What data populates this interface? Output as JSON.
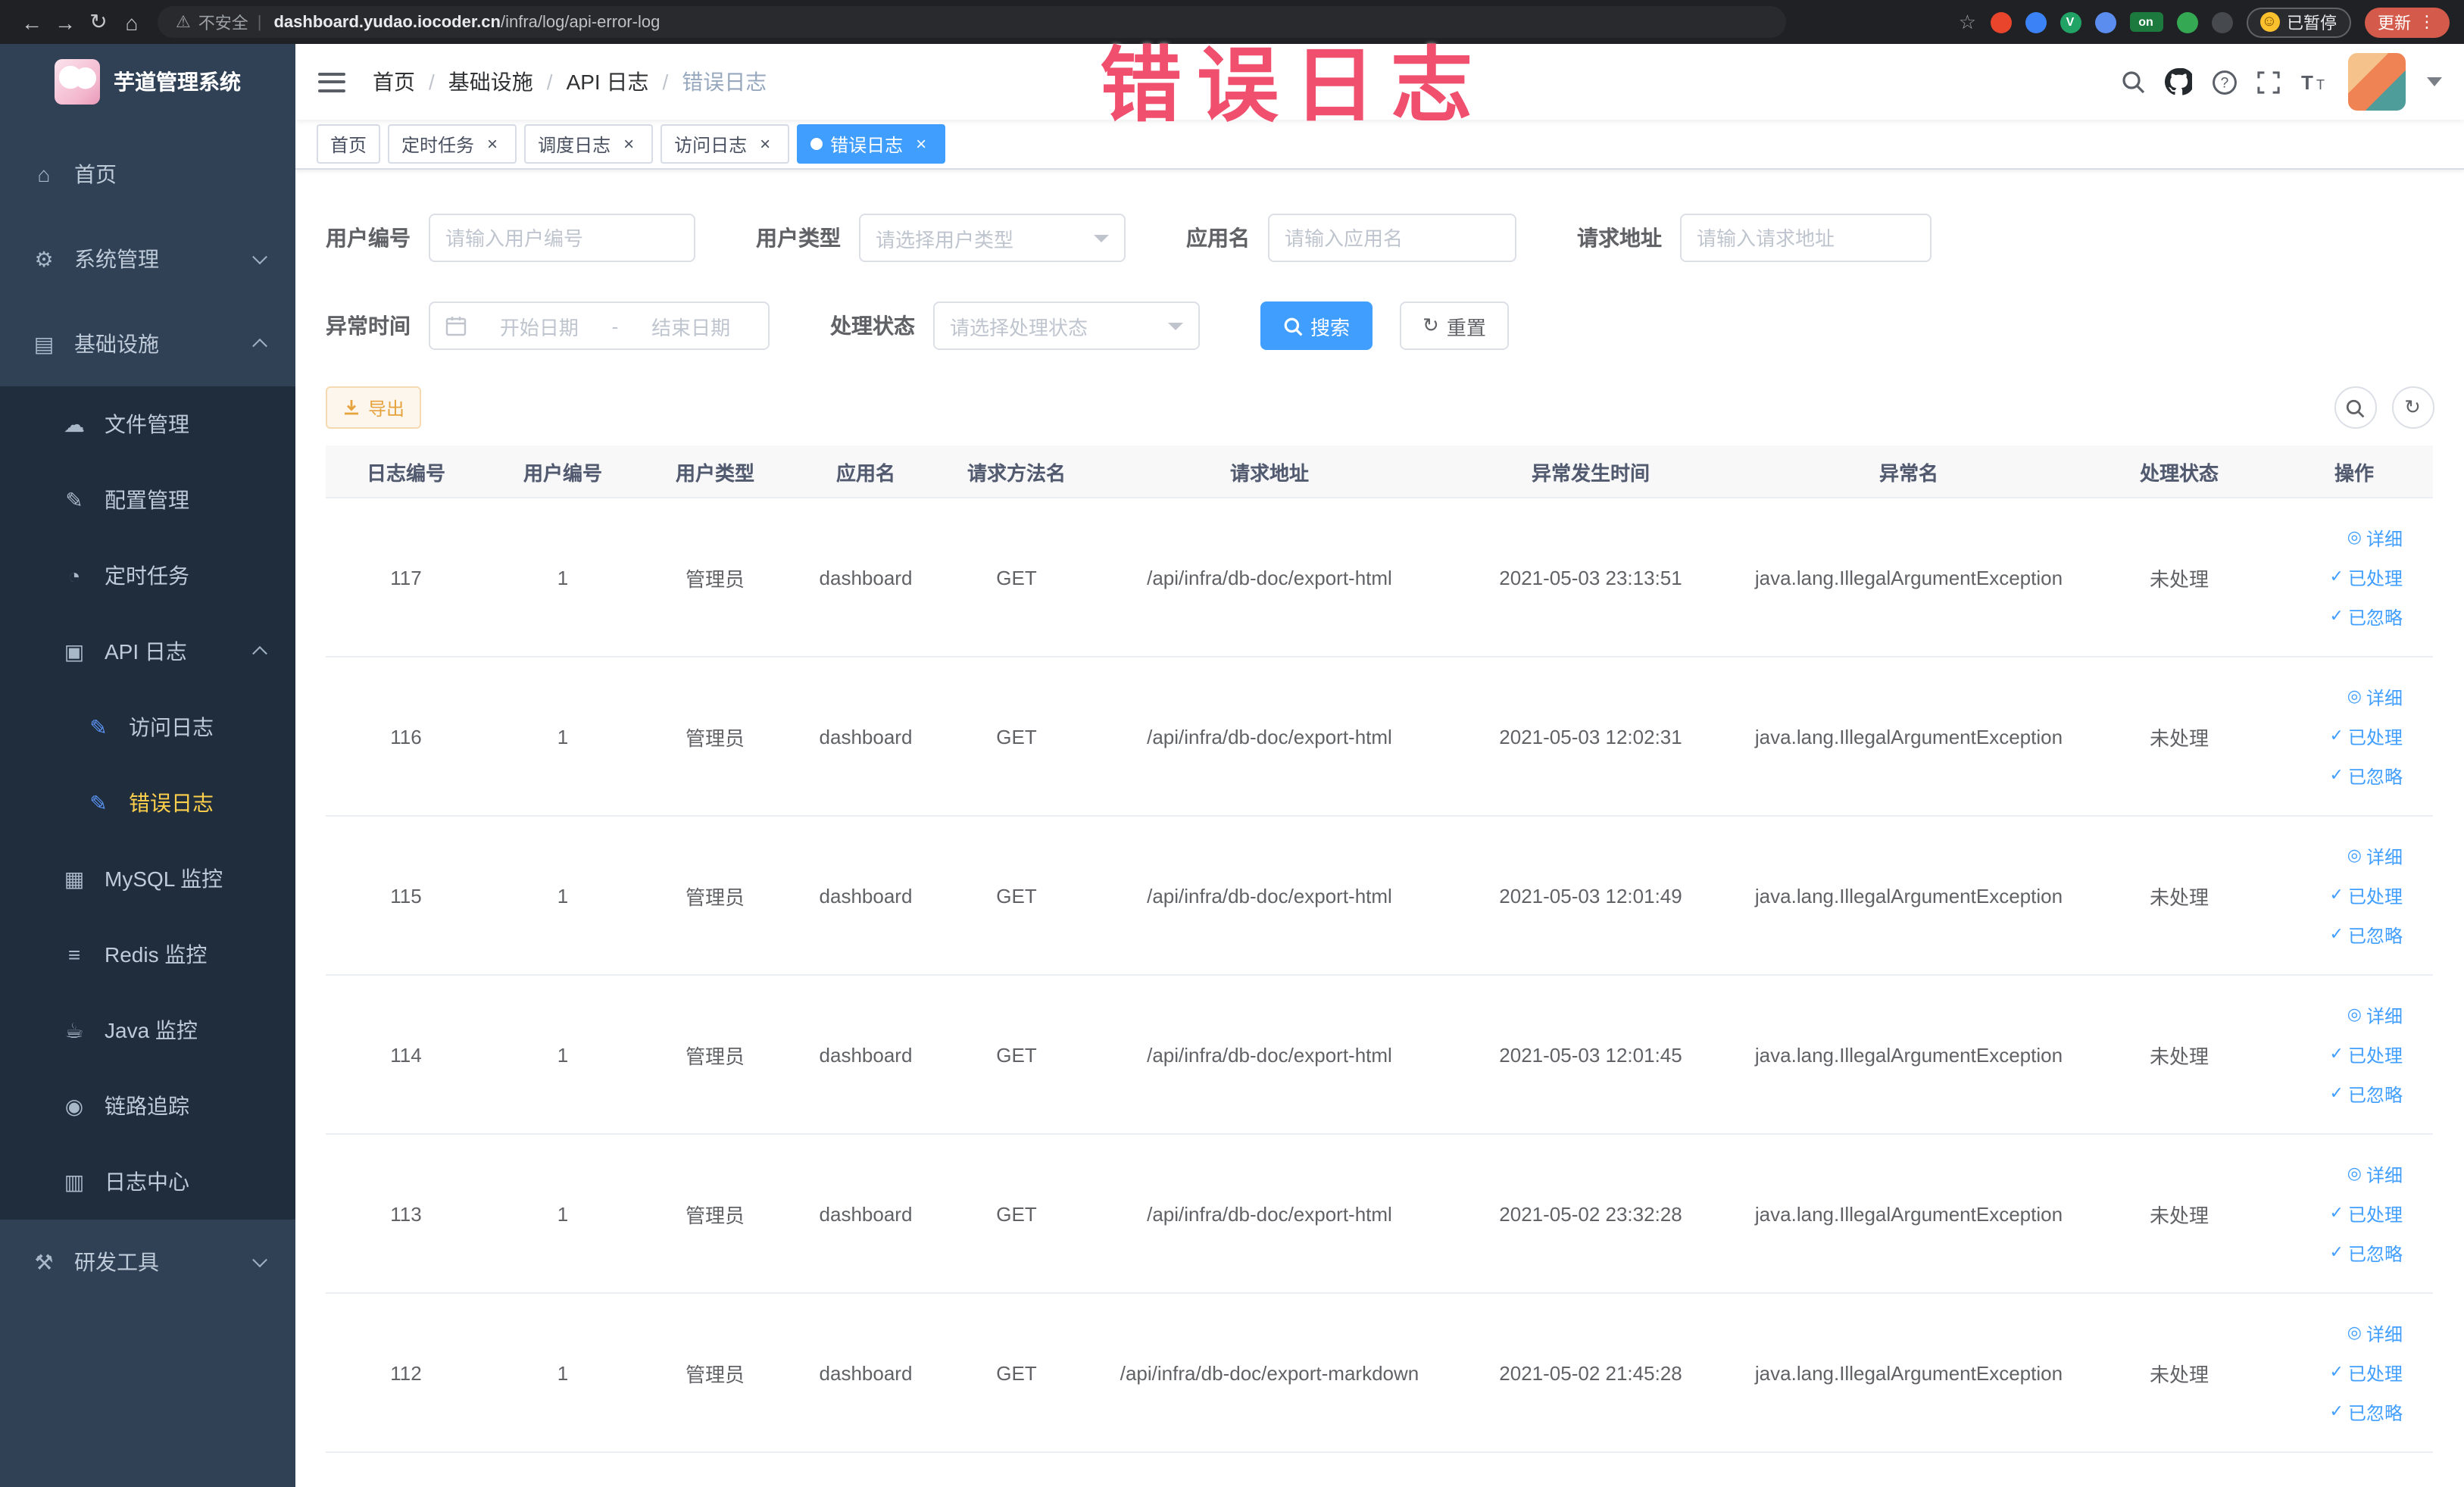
{
  "colors": {
    "primary": "#409EFF",
    "sidebar_bg": "#304156",
    "submenu_bg": "#1f2d3d",
    "active_menu_text": "#ffd04b",
    "annotation_pink": "#f0506e",
    "warning_button_text": "#e6a23c",
    "update_button_bg": "#d45b4b"
  },
  "annotation": {
    "text": "错误日志"
  },
  "browser": {
    "security_label": "不安全",
    "url_domain": "dashboard.yudao.iocoder.cn",
    "url_path": "/infra/log/api-error-log",
    "paused_label": "已暂停",
    "update_label": "更新",
    "extensions": [
      {
        "name": "extension-red-icon",
        "color": "#e8452c"
      },
      {
        "name": "extension-blue-drop-icon",
        "color": "#3b82f6"
      },
      {
        "name": "extension-green-circle-icon",
        "color": "#21a366",
        "text": "V"
      },
      {
        "name": "extension-blue-grid-icon",
        "color": "#5b8def"
      },
      {
        "name": "extension-on-badge-icon",
        "color": "#1d7a3e",
        "text": "on"
      },
      {
        "name": "extension-green-leaf-icon",
        "color": "#34a853"
      },
      {
        "name": "extension-dark-icon",
        "color": "#46494e"
      }
    ]
  },
  "sidebar": {
    "logo_title": "芋道管理系统",
    "items": [
      {
        "key": "home",
        "label": "首页",
        "icon": "home-icon",
        "level": 1
      },
      {
        "key": "system-management",
        "label": "系统管理",
        "icon": "gear-icon",
        "level": 1,
        "chevron": "down"
      },
      {
        "key": "infrastructure",
        "label": "基础设施",
        "icon": "infra-icon",
        "level": 1,
        "chevron": "up"
      },
      {
        "key": "file-management",
        "label": "文件管理",
        "icon": "file-icon",
        "level": 2
      },
      {
        "key": "config-management",
        "label": "配置管理",
        "icon": "config-icon",
        "level": 2
      },
      {
        "key": "scheduled-tasks",
        "label": "定时任务",
        "icon": "timer-icon",
        "level": 2
      },
      {
        "key": "api-logs",
        "label": "API 日志",
        "icon": "api-log-icon",
        "level": 2,
        "chevron": "up"
      },
      {
        "key": "access-logs",
        "label": "访问日志",
        "icon": "access-log-icon",
        "level": 3,
        "accent": true
      },
      {
        "key": "error-logs",
        "label": "错误日志",
        "icon": "error-log-icon",
        "level": 3,
        "accent": true,
        "active": true
      },
      {
        "key": "mysql-monitor",
        "label": "MySQL 监控",
        "icon": "mysql-icon",
        "level": 2
      },
      {
        "key": "redis-monitor",
        "label": "Redis 监控",
        "icon": "redis-icon",
        "level": 2
      },
      {
        "key": "java-monitor",
        "label": "Java 监控",
        "icon": "java-icon",
        "level": 2
      },
      {
        "key": "link-tracing",
        "label": "链路追踪",
        "icon": "trace-icon",
        "level": 2
      },
      {
        "key": "log-center",
        "label": "日志中心",
        "icon": "log-center-icon",
        "level": 2
      },
      {
        "key": "dev-tools",
        "label": "研发工具",
        "icon": "tools-icon",
        "level": 1,
        "chevron": "down"
      }
    ]
  },
  "header": {
    "breadcrumb": [
      "首页",
      "基础设施",
      "API 日志",
      "错误日志"
    ]
  },
  "tabs": [
    {
      "label": "首页",
      "closable": false,
      "active": false
    },
    {
      "label": "定时任务",
      "closable": true,
      "active": false
    },
    {
      "label": "调度日志",
      "closable": true,
      "active": false
    },
    {
      "label": "访问日志",
      "closable": true,
      "active": false
    },
    {
      "label": "错误日志",
      "closable": true,
      "active": true
    }
  ],
  "filters": {
    "user_id_label": "用户编号",
    "user_id_placeholder": "请输入用户编号",
    "user_type_label": "用户类型",
    "user_type_placeholder": "请选择用户类型",
    "app_name_label": "应用名",
    "app_name_placeholder": "请输入应用名",
    "request_url_label": "请求地址",
    "request_url_placeholder": "请输入请求地址",
    "exception_time_label": "异常时间",
    "start_date_placeholder": "开始日期",
    "range_separator": "-",
    "end_date_placeholder": "结束日期",
    "process_status_label": "处理状态",
    "process_status_placeholder": "请选择处理状态",
    "search_label": "搜索",
    "reset_label": "重置"
  },
  "toolbar": {
    "export_label": "导出"
  },
  "table": {
    "columns": [
      "日志编号",
      "用户编号",
      "用户类型",
      "应用名",
      "请求方法名",
      "请求地址",
      "异常发生时间",
      "异常名",
      "处理状态",
      "操作"
    ],
    "rows": [
      [
        "117",
        "1",
        "管理员",
        "dashboard",
        "GET",
        "/api/infra/db-doc/export-html",
        "2021-05-03 23:13:51",
        "java.lang.IllegalArgumentException",
        "未处理"
      ],
      [
        "116",
        "1",
        "管理员",
        "dashboard",
        "GET",
        "/api/infra/db-doc/export-html",
        "2021-05-03 12:02:31",
        "java.lang.IllegalArgumentException",
        "未处理"
      ],
      [
        "115",
        "1",
        "管理员",
        "dashboard",
        "GET",
        "/api/infra/db-doc/export-html",
        "2021-05-03 12:01:49",
        "java.lang.IllegalArgumentException",
        "未处理"
      ],
      [
        "114",
        "1",
        "管理员",
        "dashboard",
        "GET",
        "/api/infra/db-doc/export-html",
        "2021-05-03 12:01:45",
        "java.lang.IllegalArgumentException",
        "未处理"
      ],
      [
        "113",
        "1",
        "管理员",
        "dashboard",
        "GET",
        "/api/infra/db-doc/export-html",
        "2021-05-02 23:32:28",
        "java.lang.IllegalArgumentException",
        "未处理"
      ],
      [
        "112",
        "1",
        "管理员",
        "dashboard",
        "GET",
        "/api/infra/db-doc/export-markdown",
        "2021-05-02 21:45:28",
        "java.lang.IllegalArgumentException",
        "未处理"
      ]
    ],
    "row_actions": [
      {
        "label": "详细",
        "icon": "detail-eye-icon"
      },
      {
        "label": "已处理",
        "icon": "check-icon"
      },
      {
        "label": "已忽略",
        "icon": "check-icon"
      }
    ]
  },
  "icons": {
    "home-icon": "⌂",
    "gear-icon": "⚙",
    "infra-icon": "▤",
    "file-icon": "☁",
    "config-icon": "✎",
    "timer-icon": "◔",
    "api-log-icon": "▣",
    "access-log-icon": "✎",
    "error-log-icon": "✎",
    "mysql-icon": "▦",
    "redis-icon": "≡",
    "java-icon": "☕",
    "trace-icon": "◉",
    "log-center-icon": "▥",
    "tools-icon": "⚒",
    "detail-eye-icon": "◎",
    "check-icon": "✓",
    "refresh-icon": "↻"
  }
}
